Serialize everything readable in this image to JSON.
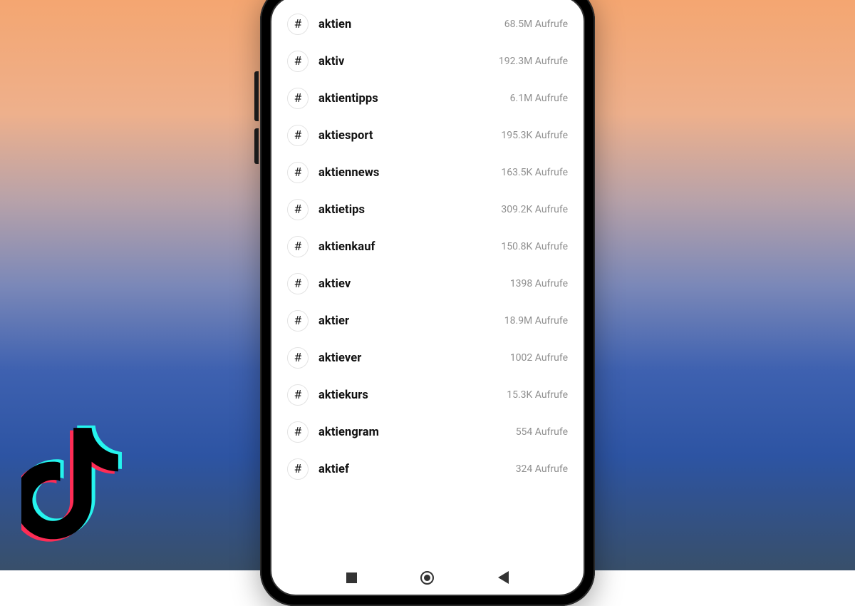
{
  "views_suffix": "Aufrufe",
  "hashtags": [
    {
      "name": "aktien",
      "views": "68.5M"
    },
    {
      "name": "aktiv",
      "views": "192.3M"
    },
    {
      "name": "aktientipps",
      "views": "6.1M"
    },
    {
      "name": "aktiesport",
      "views": "195.3K"
    },
    {
      "name": "aktiennews",
      "views": "163.5K"
    },
    {
      "name": "aktietips",
      "views": "309.2K"
    },
    {
      "name": "aktienkauf",
      "views": "150.8K"
    },
    {
      "name": "aktiev",
      "views": "1398"
    },
    {
      "name": "aktier",
      "views": "18.9M"
    },
    {
      "name": "aktiever",
      "views": "1002"
    },
    {
      "name": "aktiekurs",
      "views": "15.3K"
    },
    {
      "name": "aktiengram",
      "views": "554"
    },
    {
      "name": "aktief",
      "views": "324"
    }
  ],
  "nav": {
    "recent": "recent",
    "home": "home",
    "back": "back"
  },
  "brand": {
    "logo": "tiktok-logo"
  }
}
